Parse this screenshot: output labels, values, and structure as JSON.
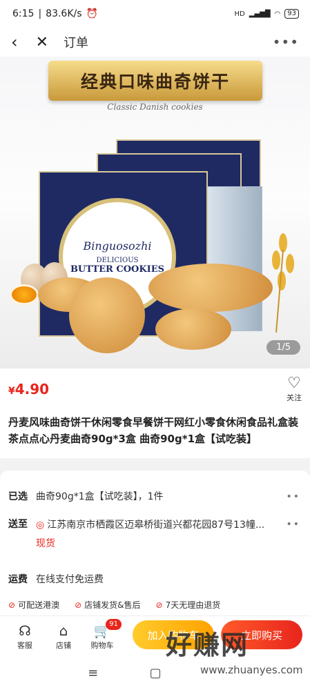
{
  "status_bar": {
    "time": "6:15",
    "speed": "83.6K/s",
    "network": "HD",
    "battery": "93"
  },
  "nav": {
    "title": "订单"
  },
  "hero": {
    "banner_title": "经典口味曲奇饼干",
    "banner_subtitle": "Classic Danish cookies",
    "tin_brand": "Binguosozhi",
    "tin_line1": "DELICIOUS",
    "tin_line2": "BUTTER COOKIES",
    "page_indicator": "1/5"
  },
  "product": {
    "price_symbol": "¥",
    "price": "4.90",
    "follow_label": "关注",
    "title": "丹麦风味曲奇饼干休闲零食早餐饼干网红小零食休闲食品礼盒装茶点点心丹麦曲奇90g*3盒 曲奇90g*1盒【试吃装】"
  },
  "info": {
    "selected_label": "已选",
    "selected_value": "曲奇90g*1盒【试吃装】，1件",
    "ship_to_label": "送至",
    "address": "江苏南京市栖霞区迈皋桥街道兴都花园87号13幢...",
    "stock": "现货",
    "shipping_label": "运费",
    "shipping_value": "在线支付免运费",
    "guarantees": [
      "可配送港澳",
      "店铺发货&售后",
      "7天无理由退货"
    ]
  },
  "bottom_bar": {
    "service": "客服",
    "store": "店铺",
    "cart": "购物车",
    "cart_count": "91",
    "add_to_cart": "加入购物车",
    "buy_now": "立即购买"
  },
  "watermark": {
    "text": "好赚网",
    "url": "www.zhuanyes.com"
  }
}
